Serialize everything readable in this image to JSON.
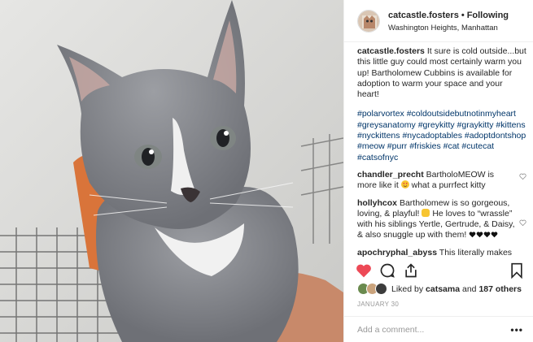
{
  "header": {
    "username": "catcastle.fosters",
    "separator": "•",
    "follow_status": "Following",
    "location": "Washington Heights, Manhattan"
  },
  "caption": {
    "username": "catcastle.fosters",
    "text": "It sure is cold outside...but this little guy could most certainly warm you up! Bartholomew Cubbins is available for adoption to warm your space and your heart!",
    "hashtags": "#polarvortex #coldoutsidebutnotinmyheart #greysanatomy #greykitty #graykitty #kittens #nyckittens #nycadoptables #adoptdontshop #meow #purr #friskies #cat #cutecat #catsofnyc"
  },
  "comments": [
    {
      "username": "chandler_precht",
      "text_before": "BartholoMEOW is more like it",
      "emoji": "heart-eyes-emoji",
      "text_after": "what a purrfect kitty"
    },
    {
      "username": "hollyhcox",
      "text_before": "Bartholomew is so gorgeous, loving, & playful!",
      "emoji": "smiling-cat-emoji",
      "text_after": "He loves to “wrassle” with his siblings Yertle, Gertrude, & Daisy, & also snuggle up with them!",
      "hearts_icon": "black-heart-emoji"
    },
    {
      "username": "apochryphal_abyss",
      "text_before": "This literally makes"
    }
  ],
  "actions": {
    "like_icon": "heart-filled-icon",
    "comment_icon": "comment-icon",
    "share_icon": "share-icon",
    "save_icon": "bookmark-icon",
    "like_color": "#ed4956"
  },
  "likes": {
    "prefix": "Liked by",
    "user": "catsama",
    "joiner": "and",
    "others": "187 others"
  },
  "date": "JANUARY 30",
  "add_comment": {
    "placeholder": "Add a comment...",
    "more_label": "•••"
  }
}
